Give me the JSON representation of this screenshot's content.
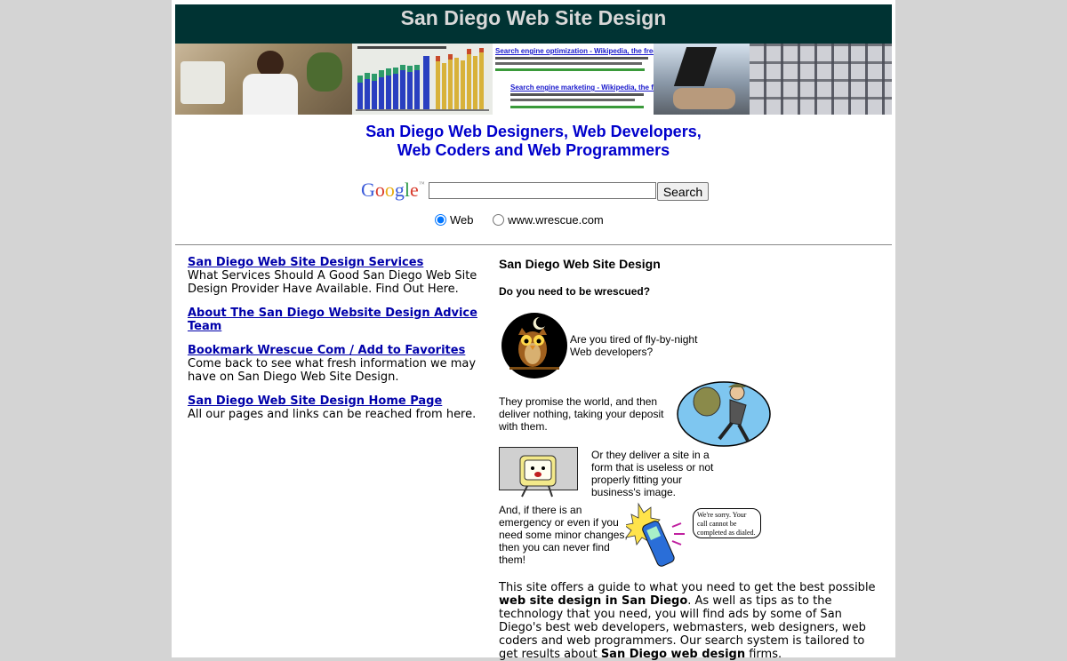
{
  "header": {
    "title": "San Diego Web Site Design"
  },
  "banner": {
    "search_result_1_title": "Search engine optimization - Wikipedia, the free e",
    "search_result_2_title": "Search engine marketing - Wikipedia, the free"
  },
  "subtitle": {
    "line1": "San Diego Web Designers, Web Developers,",
    "line2": "Web Coders and Web Programmers"
  },
  "search": {
    "logo": "Google",
    "input_value": "",
    "button_label": "Search",
    "option_web": "Web",
    "option_site": "www.wrescue.com"
  },
  "left_links": [
    {
      "title": "San Diego Web Site Design Services",
      "desc": "What Services Should A Good San Diego Web Site Design Provider Have Available. Find Out Here."
    },
    {
      "title": "About The San Diego Website Design Advice Team",
      "desc": ""
    },
    {
      "title": "Bookmark Wrescue Com / Add to Favorites",
      "desc": "Come back to see what fresh information we may have on San Diego Web Site Design."
    },
    {
      "title": "San Diego Web Site Design Home Page",
      "desc": "All our pages and links can be reached from here."
    }
  ],
  "content": {
    "section_title": "San Diego Web Site Design",
    "question": "Do you need to be wrescued?",
    "line_owl": "Are you tired of fly-by-night Web developers?",
    "line_thief": "They promise the world, and then deliver nothing, taking your deposit with them.",
    "line_computer": "Or they deliver a site in a form that is useless or not properly fitting your business's image.",
    "line_phone": "And, if there is an emergency or even if you need some minor changes, then you can never find them!",
    "phone_bubble": "We're sorry.  Your call cannot be completed as dialed.",
    "para_1": "This site offers a guide to what you need to get the best possible ",
    "para_bold_1": "web site design in San Diego",
    "para_2": ". As well as tips as to the technology that you need, you will find ads by some of San Diego's best web developers, webmasters, web designers, web coders and web programmers. Our search system is tailored to get results about ",
    "para_bold_2": "San Diego web design",
    "para_3": " firms."
  },
  "colors": {
    "header_bg": "#003333",
    "link": "#0000aa",
    "subtitle": "#0000cc",
    "page_bg": "#d4d4d4"
  }
}
